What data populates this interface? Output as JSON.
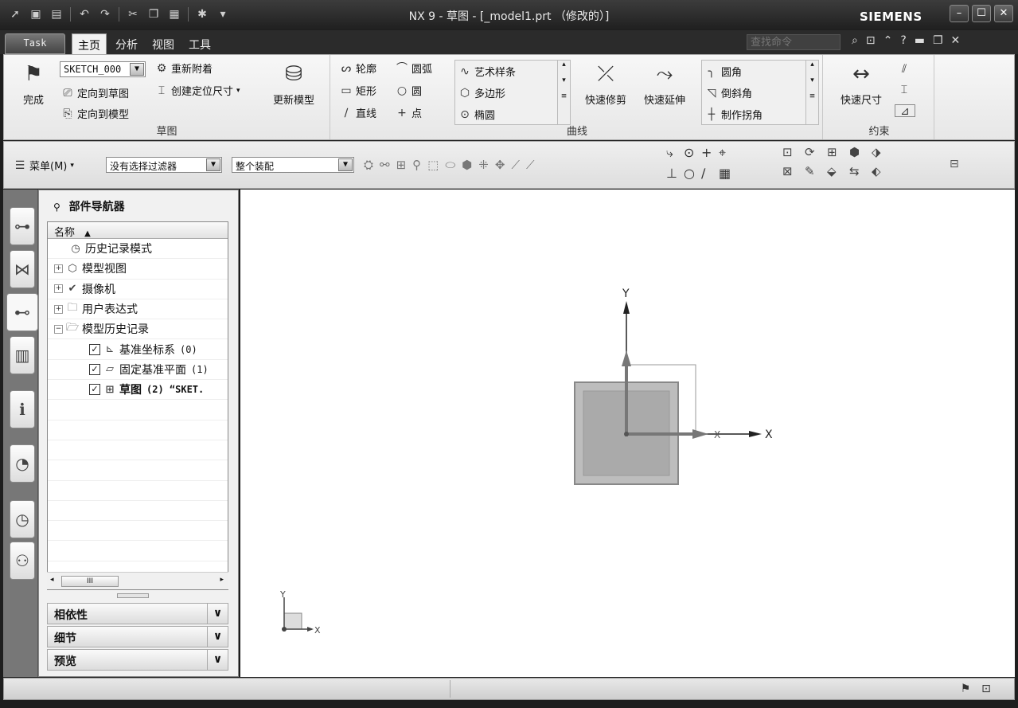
{
  "window": {
    "title": "NX 9 - 草图 - [_model1.prt （修改的）]",
    "brand": "SIEMENS"
  },
  "tabs": [
    "Task",
    "主页",
    "分析",
    "视图",
    "工具"
  ],
  "search": {
    "placeholder": "查找命令"
  },
  "ribbon": {
    "sketch_group": {
      "finish": "完成",
      "sketch_name": "SKETCH_000",
      "orient_sketch": "定向到草图",
      "orient_model": "定向到模型",
      "reattach": "重新附着",
      "create_dim": "创建定位尺寸",
      "update_model": "更新模型",
      "label": "草图"
    },
    "curve_group": {
      "profile": "轮廓",
      "arc": "圆弧",
      "rectangle": "矩形",
      "circle": "圆",
      "line": "直线",
      "point": "点",
      "studio_spline": "艺术样条",
      "polygon": "多边形",
      "ellipse": "椭圆",
      "quick_trim": "快速修剪",
      "quick_extend": "快速延伸",
      "fillet": "圆角",
      "chamfer": "倒斜角",
      "make_corner": "制作拐角",
      "label": "曲线"
    },
    "constraint_group": {
      "rapid_dim": "快速尺寸",
      "label": "约束"
    }
  },
  "toolbar2": {
    "menu": "菜单(M)",
    "filter": "没有选择过滤器",
    "scope": "整个装配"
  },
  "navigator": {
    "title": "部件导航器",
    "column": "名称",
    "items": [
      {
        "label": "历史记录模式"
      },
      {
        "label": "模型视图"
      },
      {
        "label": "摄像机"
      },
      {
        "label": "用户表达式"
      },
      {
        "label": "模型历史记录"
      },
      {
        "label": "基准坐标系",
        "suffix": "(0)"
      },
      {
        "label": "固定基准平面",
        "suffix": "(1)"
      },
      {
        "label": "草图",
        "suffix": "(2) “SKET."
      }
    ],
    "panels": [
      "相依性",
      "细节",
      "预览"
    ]
  },
  "graphics": {
    "axis_x": "X",
    "axis_y": "Y",
    "triad_x": "X",
    "triad_y": "Y"
  },
  "icons": {
    "finish": "checkered-flag-icon",
    "gear": "settings-icon"
  },
  "colors": {
    "titlebar": "#2a2a2a",
    "ribbon": "#efefef",
    "canvas": "#ffffff"
  }
}
